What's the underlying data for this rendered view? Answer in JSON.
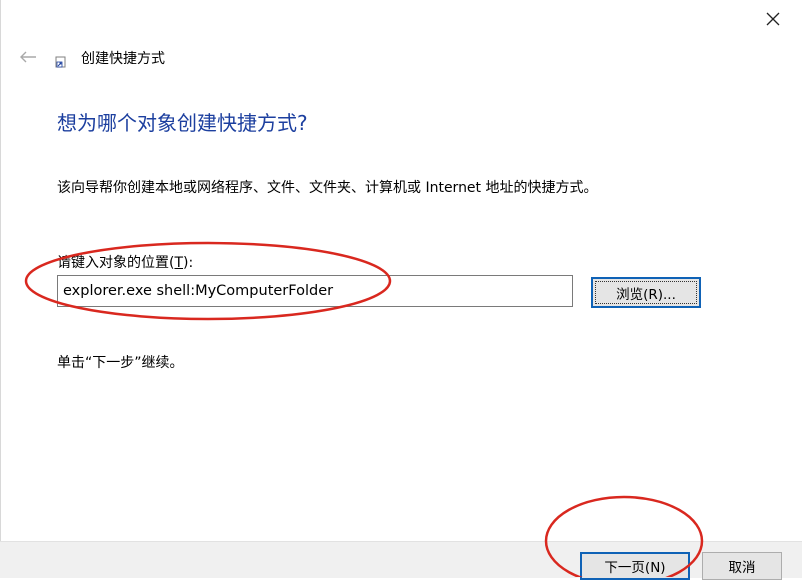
{
  "wizard": {
    "title": "创建快捷方式",
    "heading": "想为哪个对象创建快捷方式?",
    "description": "该向导帮你创建本地或网络程序、文件、文件夹、计算机或 Internet 地址的快捷方式。",
    "location_label_prefix": "请键入对象的位置(",
    "location_label_key": "T",
    "location_label_suffix": "):",
    "location_value": "explorer.exe shell:MyComputerFolder",
    "browse_label": "浏览(R)...",
    "hint": "单击“下一步”继续。"
  },
  "footer": {
    "next_label": "下一页(N)",
    "cancel_label": "取消"
  },
  "icons": {
    "close": "close-icon",
    "back": "back-arrow-icon",
    "wizard": "shortcut-wizard-icon"
  },
  "colors": {
    "heading": "#1c3f9f",
    "button_focus_border": "#0f62b6",
    "annotation": "#d9281f"
  }
}
